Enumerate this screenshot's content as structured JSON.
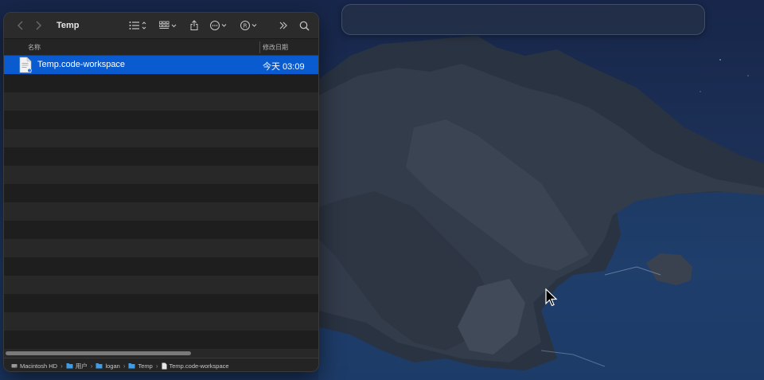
{
  "window": {
    "title": "Temp"
  },
  "toolbar": {
    "back_icon": "chevron-left-icon",
    "forward_icon": "chevron-right-icon",
    "view_icon": "list-view-icon",
    "group_icon": "grid-icon",
    "share_icon": "share-icon",
    "more_icon": "ellipsis-circle-icon",
    "tag_icon": "tag-icon",
    "overflow_icon": "double-chevron-icon",
    "search_icon": "search-icon"
  },
  "columns": {
    "name": "名称",
    "date_modified": "修改日期"
  },
  "files": [
    {
      "name": "Temp.code-workspace",
      "date": "今天 03:09",
      "icon": "document-icon",
      "selected": true
    }
  ],
  "pathbar": {
    "items": [
      {
        "label": "Macintosh HD",
        "icon": "drive-icon"
      },
      {
        "label": "用户",
        "icon": "folder-icon"
      },
      {
        "label": "logan",
        "icon": "folder-icon"
      },
      {
        "label": "Temp",
        "icon": "folder-icon"
      },
      {
        "label": "Temp.code-workspace",
        "icon": "document-icon"
      }
    ]
  },
  "colors": {
    "selection": "#0a5bd0",
    "folder": "#3d9be9"
  }
}
